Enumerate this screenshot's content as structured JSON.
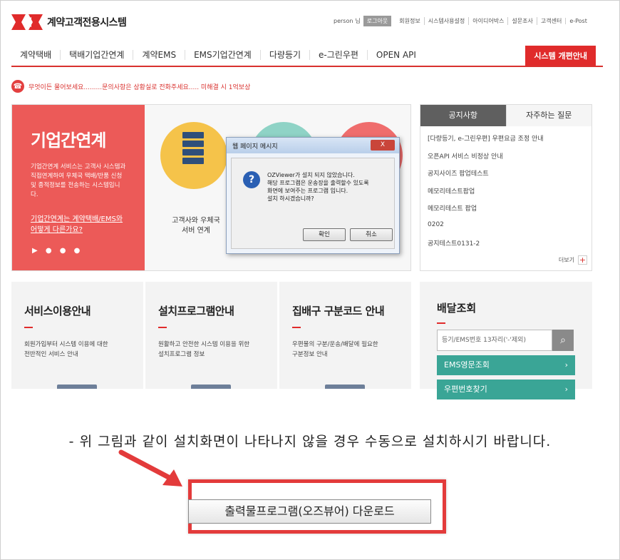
{
  "header": {
    "logo_text": "계약고객전용시스템",
    "user_name": "person",
    "user_suffix": "님",
    "logout_label": "로그아웃",
    "util_links": [
      "회원정보",
      "시스템사용설정",
      "아이디어박스",
      "설문조사",
      "고객센터",
      "e-Post"
    ]
  },
  "gnb": {
    "menus": [
      "계약택배",
      "택배기업간연계",
      "계약EMS",
      "EMS기업간연계",
      "다량등기",
      "e-그린우편",
      "OPEN API"
    ],
    "notice_button": "시스템 개편안내"
  },
  "alert": {
    "icon": "alarm-icon",
    "text": "무엇이든 물어보세요.........문의사항은 상황실로 전화주세요..... 미해결 시 1억보상"
  },
  "banner": {
    "title": "기업간연계",
    "description": "기업간연계 서비스는 고객사 시스템과 직접연계하여 우체국 택배/반품 신청 및 종적정보를 전송하는 시스템입니다.",
    "link_line1": "기업간연계는 계약택배/EMS와",
    "link_line2": "어떻게 다른가요?",
    "caption_line1": "고객사와 우체국",
    "caption_line2": "서버 연계"
  },
  "dialog": {
    "title": "웹 페이지 메시지",
    "close_label": "X",
    "icon": "question-icon",
    "message_line1": "OZViewer가 설치 되지 않았습니다.",
    "message_line2": "해당 프로그램은 운송장을 출력할수 있도록",
    "message_line3": "화면에 보여주는 프로그램 입니다.",
    "message_line4": "설치 하시겠습니까?",
    "ok_label": "확인",
    "cancel_label": "취소"
  },
  "notice": {
    "tab_active": "공지사항",
    "tab_inactive": "자주하는 질문",
    "items": [
      "[다량등기, e-그린우편] 우편요금 조정 안내",
      "오픈API 서비스 비정상 안내",
      "공지사이즈 팝업테스트",
      "메모리테스트팝업",
      "메모리테스트 팝업",
      "0202",
      "공지테스트0131-2"
    ],
    "more_label": "더보기",
    "more_plus": "+"
  },
  "cards": [
    {
      "title": "서비스이용안내",
      "desc_line1": "회원가입부터 시스템 이용에 대한",
      "desc_line2": "전반적인 서비스 안내"
    },
    {
      "title": "설치프로그램안내",
      "desc_line1": "원활하고 안전한 시스템 이용을 위한",
      "desc_line2": "설치프로그램 정보"
    },
    {
      "title": "집배구 구분코드 안내",
      "desc_line1": "우편물의 구분/운송/배달에 필요한",
      "desc_line2": "구분정보 안내"
    }
  ],
  "delivery": {
    "title": "배달조회",
    "placeholder": "등기/EMS번호 13자리('-'제외)",
    "search_icon": "search-icon",
    "buttons": [
      "EMS영문조회",
      "우편번호찾기"
    ],
    "chevron": "›"
  },
  "instruction": {
    "text": "- 위 그림과 같이 설치화면이 나타나지 않을 경우 수동으로 설치하시기 바랍니다."
  },
  "download": {
    "label": "출력물프로그램(오즈뷰어) 다운로드"
  },
  "colors": {
    "accent_red": "#e02b2b",
    "banner_red": "#ec5a58",
    "teal": "#3aa596",
    "highlight": "#e33b3b"
  }
}
